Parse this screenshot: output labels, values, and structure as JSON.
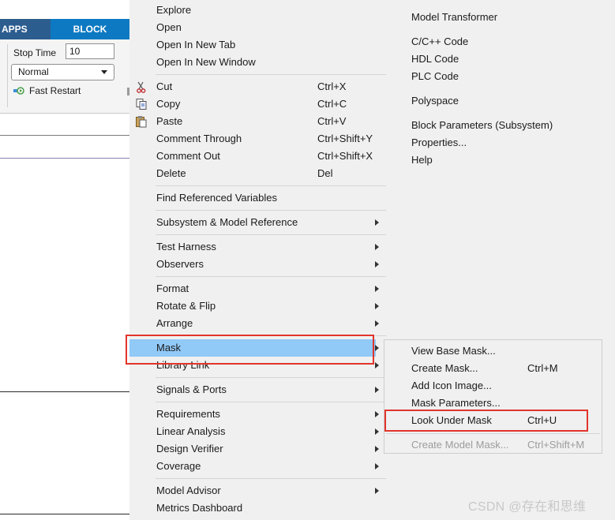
{
  "ribbon": {
    "tabs": [
      "APPS",
      "BLOCK"
    ],
    "stop_time_label": "Stop Time",
    "stop_time_value": "10",
    "sim_mode": "Normal",
    "fast_restart_label": "Fast Restart"
  },
  "colors": {
    "tab_strip": "#2c5d8f",
    "active_tab": "#0d79c2",
    "menu_background": "#f0f0f0",
    "hover_highlight": "#91c9f7",
    "annotation_red": "#e1352c"
  },
  "menu": {
    "explore": "Explore",
    "open": "Open",
    "open_new_tab": "Open In New Tab",
    "open_new_window": "Open In New Window",
    "cut": {
      "label": "Cut",
      "shortcut": "Ctrl+X",
      "icon": "scissors-icon"
    },
    "copy": {
      "label": "Copy",
      "shortcut": "Ctrl+C",
      "icon": "copy-icon"
    },
    "paste": {
      "label": "Paste",
      "shortcut": "Ctrl+V",
      "icon": "paste-icon"
    },
    "comment_through": {
      "label": "Comment Through",
      "shortcut": "Ctrl+Shift+Y"
    },
    "comment_out": {
      "label": "Comment Out",
      "shortcut": "Ctrl+Shift+X"
    },
    "delete": {
      "label": "Delete",
      "shortcut": "Del"
    },
    "find_referenced_variables": "Find Referenced Variables",
    "subsystem_model_reference": "Subsystem & Model Reference",
    "test_harness": "Test Harness",
    "observers": "Observers",
    "format": "Format",
    "rotate_flip": "Rotate & Flip",
    "arrange": "Arrange",
    "mask": "Mask",
    "library_link": "Library Link",
    "signals_ports": "Signals & Ports",
    "requirements": "Requirements",
    "linear_analysis": "Linear Analysis",
    "design_verifier": "Design Verifier",
    "coverage": "Coverage",
    "model_advisor": "Model Advisor",
    "metrics_dashboard": "Metrics Dashboard"
  },
  "menu_col2": {
    "model_transformer": "Model Transformer",
    "c_cpp_code": "C/C++ Code",
    "hdl_code": "HDL Code",
    "plc_code": "PLC Code",
    "polyspace": "Polyspace",
    "block_parameters": "Block Parameters (Subsystem)",
    "properties": "Properties...",
    "help": "Help"
  },
  "submenu": {
    "view_base_mask": "View Base Mask...",
    "create_mask": {
      "label": "Create Mask...",
      "shortcut": "Ctrl+M"
    },
    "add_icon_image": "Add Icon Image...",
    "mask_parameters": "Mask Parameters...",
    "look_under_mask": {
      "label": "Look Under Mask",
      "shortcut": "Ctrl+U"
    },
    "create_model_mask": {
      "label": "Create Model Mask...",
      "shortcut": "Ctrl+Shift+M"
    }
  },
  "watermark": "CSDN @存在和思维"
}
